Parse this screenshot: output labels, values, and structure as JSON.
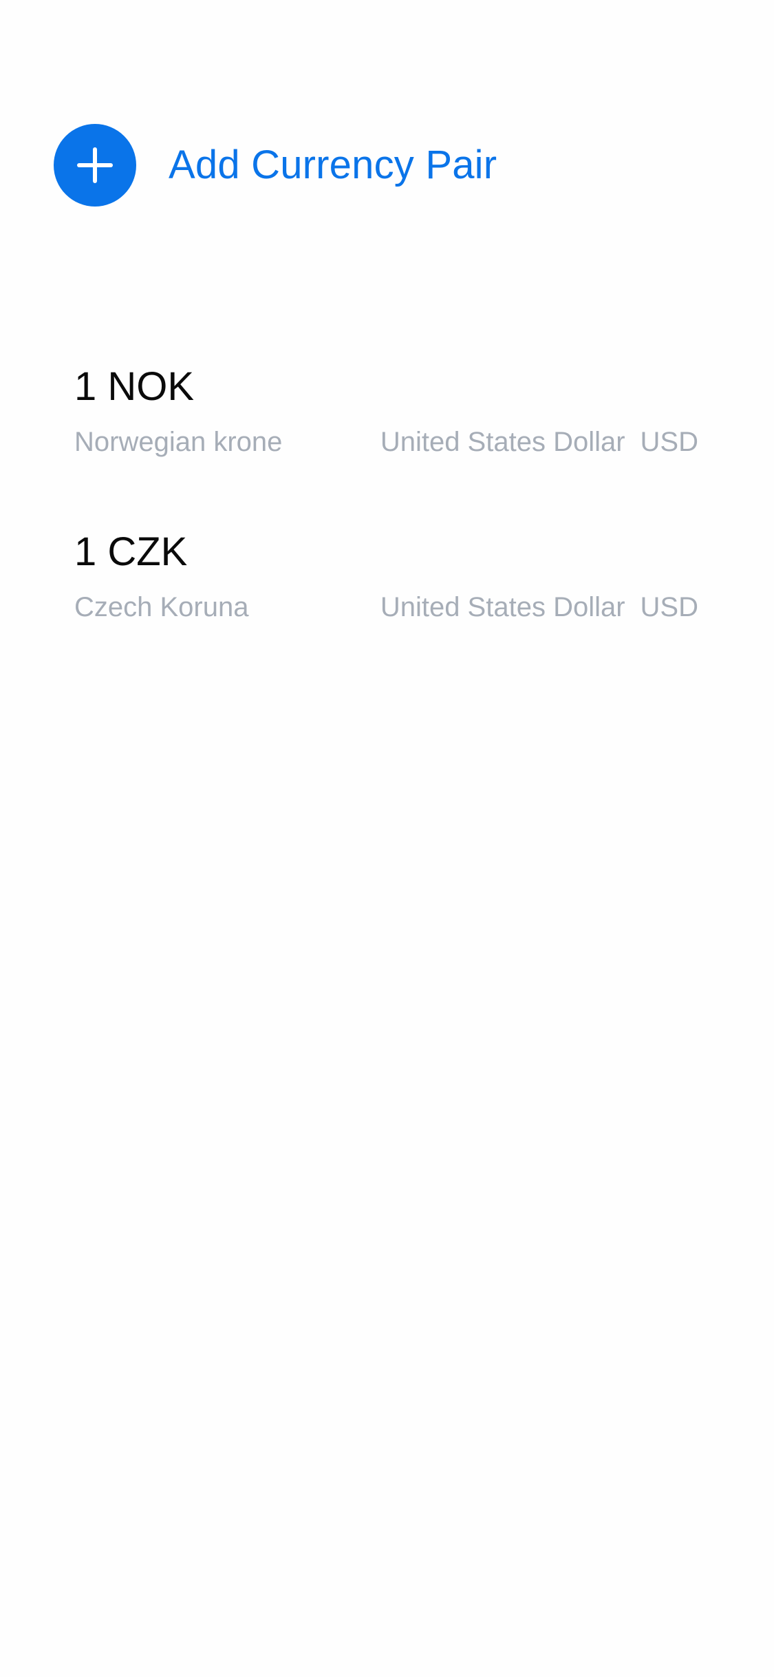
{
  "add_pair": {
    "label": "Add Currency Pair",
    "icon": "plus-icon",
    "color": "#0a74e9"
  },
  "pairs": [
    {
      "amount": "1 NOK",
      "from_name": "Norwegian krone",
      "to_name": "United States Dollar",
      "to_code": "USD"
    },
    {
      "amount": "1 CZK",
      "from_name": "Czech Koruna",
      "to_name": "United States Dollar",
      "to_code": "USD"
    }
  ]
}
